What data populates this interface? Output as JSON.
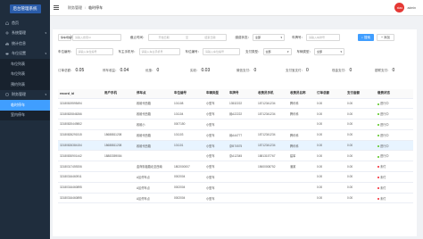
{
  "brand": "后台管理系统",
  "sidebar": {
    "items": [
      {
        "label": "首页",
        "icon": "home-icon"
      },
      {
        "label": "系统管理",
        "icon": "gear-icon",
        "caret": "▾"
      },
      {
        "label": "统计信息",
        "icon": "chart-icon"
      },
      {
        "label": "车位设置",
        "icon": "car-icon",
        "caret": "▾"
      },
      {
        "label": "车位列表",
        "sub": true
      },
      {
        "label": "车位列表",
        "sub": true
      },
      {
        "label": "预约列表",
        "sub": true
      },
      {
        "label": "财务管理",
        "icon": "wallet-icon",
        "caret": "▾"
      },
      {
        "label": "临时停车",
        "sub": true,
        "active": true
      },
      {
        "label": "室内停车",
        "sub": true
      }
    ]
  },
  "header": {
    "crumbs": [
      "财务管理",
      "临时停车"
    ],
    "separator": "/",
    "avatar_text": "xiao",
    "username": "admin"
  },
  "filters": {
    "row1": {
      "id_placeholder": "请输入搜索Id",
      "id_select": "停车场编号",
      "date_label": "截止时间：",
      "date_start": "开始日期",
      "date_sep": "至",
      "date_end": "结束日期",
      "status_label": "缴费状态：",
      "status_value": "全部",
      "plate_label": "车牌号：",
      "plate_placeholder": "请输入车牌号",
      "search_btn": "搜索",
      "add_btn": "添加"
    },
    "row2": {
      "l1": "车位编号：",
      "p1": "请输入车位编号",
      "l2": "车主手机号：",
      "p2": "请输入车主手机号",
      "l3": "车位编号：",
      "p3": "请输入车位编号",
      "l4": "支付类型：",
      "v4": "全部",
      "l5": "车辆类型：",
      "v5": "全部"
    }
  },
  "summary": [
    {
      "label": "订单总额：",
      "value": "0.05"
    },
    {
      "label": "停车收益：",
      "value": "0.04"
    },
    {
      "label": "优惠：",
      "value": "0"
    },
    {
      "label": "实收：",
      "value": "0.03"
    },
    {
      "label": "微信支付：",
      "value": "0"
    },
    {
      "label": "支付宝支付：",
      "value": "0"
    },
    {
      "label": "现金支付：",
      "value": "0"
    },
    {
      "label": "银联支付：",
      "value": "0"
    }
  ],
  "table": {
    "columns": [
      "record_id",
      "用户手机",
      "停车点",
      "车位编号",
      "车辆类型",
      "车牌号",
      "收费员手机",
      "收费员名称",
      "订单总额",
      "支付金额",
      "缴费状态"
    ],
    "rows": [
      [
        "32180819595494",
        "",
        "政维代西路",
        "101108",
        "小型车",
        "",
        "13532222",
        "18712341234",
        "腾讯科",
        "0.00",
        "0.00",
        "进行中"
      ],
      [
        "32180820846266",
        "",
        "政维代西路",
        "101104",
        "小型车",
        "",
        "赣A22222",
        "18712341234",
        "腾讯科",
        "0.00",
        "0.00",
        "进行中"
      ],
      [
        "32180820449802",
        "",
        "政维小",
        "0007150",
        "小型车",
        "",
        "",
        "",
        "",
        "0.00",
        "0.00",
        "进行中"
      ],
      [
        "32180826291515",
        "18688811208",
        "政维代西路",
        "101103",
        "小型车",
        "",
        "赣A44777",
        "18712341234",
        "腾讯科",
        "0.00",
        "0.00",
        "进行中"
      ],
      [
        "32180826384154",
        "18688811208",
        "政维代西路",
        "101101",
        "小型车",
        "",
        "京B70575",
        "18712341234",
        "腾讯科",
        "0.00",
        "0.00",
        "进行中"
      ],
      [
        "32180830901442",
        "18883359084",
        "",
        "",
        "小型车",
        "",
        "京A12345",
        "18813157767",
        "建军",
        "0.00",
        "0.00",
        "进行中"
      ],
      [
        "32180317459206",
        "",
        "金商街福路北至西南",
        "1802000007",
        "小型车",
        "",
        "",
        "15600008752",
        "潘某",
        "0.00",
        "0.00",
        "未付"
      ],
      [
        "32180316460911",
        "",
        "A区停车点",
        "0002004",
        "小型车",
        "",
        "",
        "",
        "",
        "0.00",
        "0.00",
        "未付"
      ],
      [
        "32180316460895",
        "",
        "A区停车点",
        "0002004",
        "小型车",
        "",
        "",
        "",
        "",
        "0.00",
        "0.00",
        "未付"
      ],
      [
        "32180316460895",
        "",
        "A区停车点",
        "0002004",
        "小型车",
        "",
        "",
        "",
        "",
        "0.00",
        "0.00",
        "未付"
      ]
    ]
  },
  "colors": {
    "sidebar_bg": "#1f2d3d",
    "accent": "#409eff",
    "active_status": "#52c41a",
    "unpaid_status": "#f5222d"
  }
}
